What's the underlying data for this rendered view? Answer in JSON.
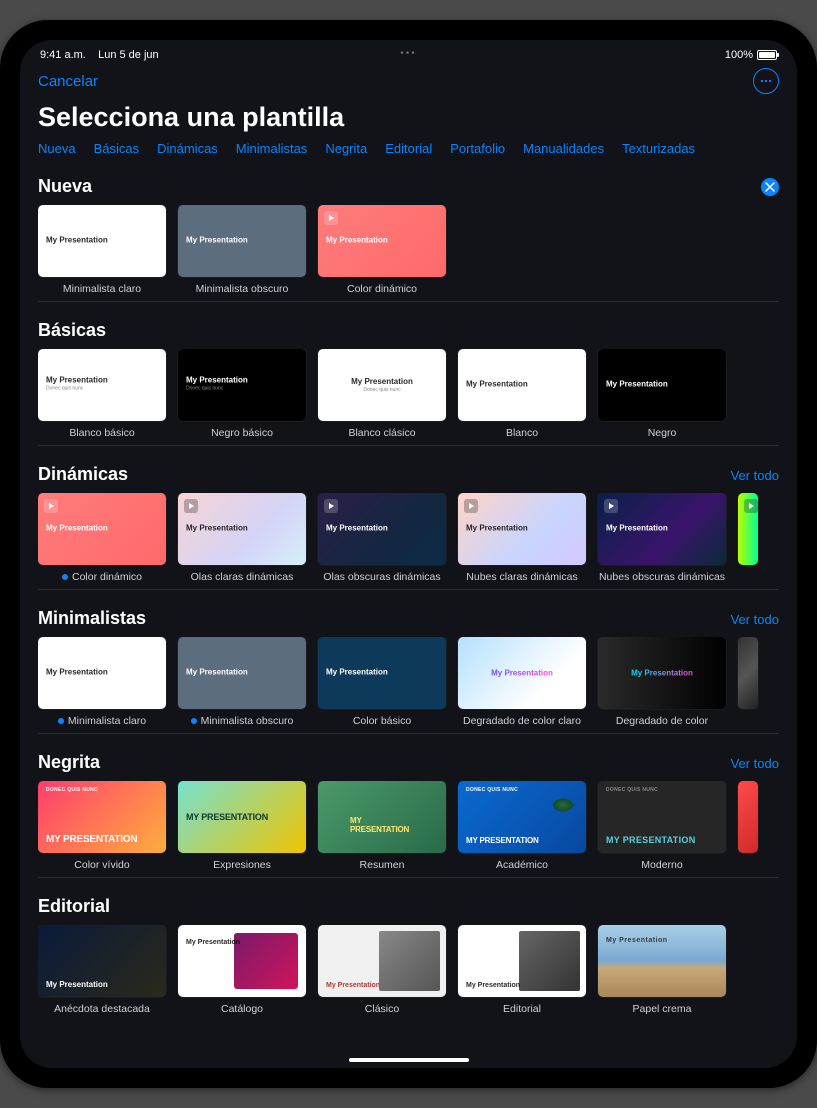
{
  "status": {
    "time": "9:41 a.m.",
    "date": "Lun 5 de jun",
    "battery": "100%"
  },
  "toolbar": {
    "cancel": "Cancelar"
  },
  "title": "Selecciona una plantilla",
  "tabs": [
    "Nueva",
    "Básicas",
    "Dinámicas",
    "Minimalistas",
    "Negrita",
    "Editorial",
    "Portafolio",
    "Manualidades",
    "Texturizadas"
  ],
  "see_all": "Ver todo",
  "thumb_text": "My Presentation",
  "thumb_sub": "Donec quis nunc",
  "sections": {
    "nueva": {
      "title": "Nueva",
      "items": [
        {
          "label": "Minimalista claro",
          "variant": "bg-white",
          "dark": false,
          "play": false,
          "dot": false
        },
        {
          "label": "Minimalista obscuro",
          "variant": "bg-slate",
          "dark": true,
          "play": false,
          "dot": false
        },
        {
          "label": "Color dinámico",
          "variant": "bg-coral",
          "dark": true,
          "play": true,
          "dot": false
        }
      ]
    },
    "basicas": {
      "title": "Básicas",
      "items": [
        {
          "label": "Blanco básico",
          "variant": "bg-white",
          "dark": false
        },
        {
          "label": "Negro básico",
          "variant": "bg-black",
          "dark": true
        },
        {
          "label": "Blanco clásico",
          "variant": "bg-white",
          "dark": false,
          "center": true
        },
        {
          "label": "Blanco",
          "variant": "bg-white",
          "dark": false
        },
        {
          "label": "Negro",
          "variant": "bg-black",
          "dark": true
        }
      ]
    },
    "dinamicas": {
      "title": "Dinámicas",
      "see_all": true,
      "items": [
        {
          "label": "Color dinámico",
          "variant": "bg-coral",
          "dark": true,
          "play": true,
          "dot": true
        },
        {
          "label": "Olas claras dinámicas",
          "variant": "bg-wave-light",
          "dark": false,
          "play": true
        },
        {
          "label": "Olas obscuras dinámicas",
          "variant": "bg-wave-dark",
          "dark": true,
          "play": true
        },
        {
          "label": "Nubes claras dinámicas",
          "variant": "bg-cloud-light",
          "dark": false,
          "play": true
        },
        {
          "label": "Nubes obscuras dinámicas",
          "variant": "bg-cloud-dark",
          "dark": true,
          "play": true
        },
        {
          "label": "",
          "variant": "bg-neon",
          "dark": false,
          "play": true,
          "peek": true
        }
      ]
    },
    "minimalistas": {
      "title": "Minimalistas",
      "see_all": true,
      "items": [
        {
          "label": "Minimalista claro",
          "variant": "bg-white",
          "dark": false,
          "dot": true
        },
        {
          "label": "Minimalista obscuro",
          "variant": "bg-slate",
          "dark": true,
          "dot": true
        },
        {
          "label": "Color básico",
          "variant": "bg-navy",
          "dark": true
        },
        {
          "label": "Degradado de color claro",
          "variant": "bg-grad-light",
          "dark": false,
          "center": true,
          "gradtxt": true
        },
        {
          "label": "Degradado de color",
          "variant": "bg-grad-dark",
          "dark": true,
          "center": true,
          "gradtxt": true
        },
        {
          "label": "",
          "variant": "bg-blur",
          "dark": true,
          "peek": true
        }
      ]
    },
    "negrita": {
      "title": "Negrita",
      "see_all": true,
      "items": [
        {
          "label": "Color vívido",
          "variant": "bg-vivid",
          "bold": true
        },
        {
          "label": "Expresiones",
          "variant": "bg-expr",
          "bold": true,
          "boldleft": true
        },
        {
          "label": "Resumen",
          "variant": "bg-summary",
          "bold": true,
          "center": true
        },
        {
          "label": "Académico",
          "variant": "bg-academic",
          "bold": true,
          "turtle": true
        },
        {
          "label": "Moderno",
          "variant": "bg-modern",
          "bold": true,
          "modern": true
        },
        {
          "label": "",
          "variant": "bg-red",
          "peek": true
        }
      ]
    },
    "editorial": {
      "title": "Editorial",
      "items": [
        {
          "label": "Anécdota destacada",
          "variant": "bg-anecdote",
          "dark": true,
          "bottom": true
        },
        {
          "label": "Catálogo",
          "variant": "bg-catalog",
          "dark": false
        },
        {
          "label": "Clásico",
          "variant": "bg-classic",
          "dark": false,
          "photo": true
        },
        {
          "label": "Editorial",
          "variant": "bg-editorial",
          "dark": false,
          "photo": true
        },
        {
          "label": "Papel crema",
          "variant": "bg-cream",
          "dark": false,
          "cliff": true
        }
      ]
    }
  }
}
